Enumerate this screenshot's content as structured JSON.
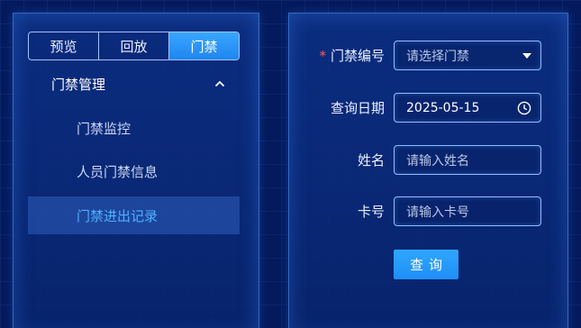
{
  "tabs": [
    {
      "label": "预览",
      "active": false
    },
    {
      "label": "回放",
      "active": false
    },
    {
      "label": "门禁",
      "active": true
    }
  ],
  "menu": {
    "group_label": "门禁管理",
    "group_expanded": true,
    "items": [
      {
        "label": "门禁监控",
        "active": false
      },
      {
        "label": "人员门禁信息",
        "active": false
      },
      {
        "label": "门禁进出记录",
        "active": true
      }
    ]
  },
  "form": {
    "door_no": {
      "label": "门禁编号",
      "required": true,
      "placeholder": "请选择门禁"
    },
    "query_date": {
      "label": "查询日期",
      "value": "2025-05-15"
    },
    "name": {
      "label": "姓名",
      "placeholder": "请输入姓名"
    },
    "card_no": {
      "label": "卡号",
      "placeholder": "请输入卡号"
    },
    "submit_label": "查询"
  },
  "colors": {
    "background": "#041a5c",
    "accent": "#2fa6ff",
    "active_text": "#4fb0ff",
    "required_mark": "#ff5b5b"
  }
}
